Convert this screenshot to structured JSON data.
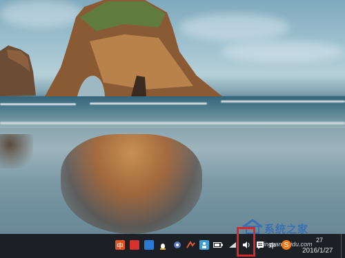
{
  "desktop": {
    "wallpaper": "sea-arch-rock"
  },
  "taskbar": {
    "tray_icons": [
      {
        "name": "ime-chinese-icon",
        "glyph": "中",
        "color": "#e6521f"
      },
      {
        "name": "red-app-icon",
        "glyph": "",
        "color": "#d8302f"
      },
      {
        "name": "blue-app-icon",
        "glyph": "",
        "color": "#2a7bd6"
      },
      {
        "name": "qq-penguin-icon",
        "glyph": "",
        "color": "#2b2b2b"
      },
      {
        "name": "network-app-icon",
        "glyph": "",
        "color": "#5a79c9"
      },
      {
        "name": "transfer-app-icon",
        "glyph": "",
        "color": "#e05a3a"
      },
      {
        "name": "people-app-icon",
        "glyph": "",
        "color": "#3aa1d8"
      },
      {
        "name": "battery-icon",
        "glyph": "",
        "color": "#ffffff"
      },
      {
        "name": "wifi-icon",
        "glyph": "",
        "color": "#ffffff"
      },
      {
        "name": "volume-icon",
        "glyph": "🔊",
        "color": "#ffffff"
      },
      {
        "name": "action-center-icon",
        "glyph": "",
        "color": "#ffffff"
      },
      {
        "name": "input-method-icon",
        "glyph": "中",
        "color": "#ffffff"
      },
      {
        "name": "sogou-icon",
        "glyph": "S",
        "color": "#f07a1a"
      }
    ],
    "clock": {
      "time": "27",
      "date": "2016/1/27"
    }
  },
  "watermark": {
    "brand": "系统之家",
    "url": "jingyan.baidu.com"
  },
  "colors": {
    "highlight": "#d9262a",
    "taskbar": "#1c1f24"
  }
}
